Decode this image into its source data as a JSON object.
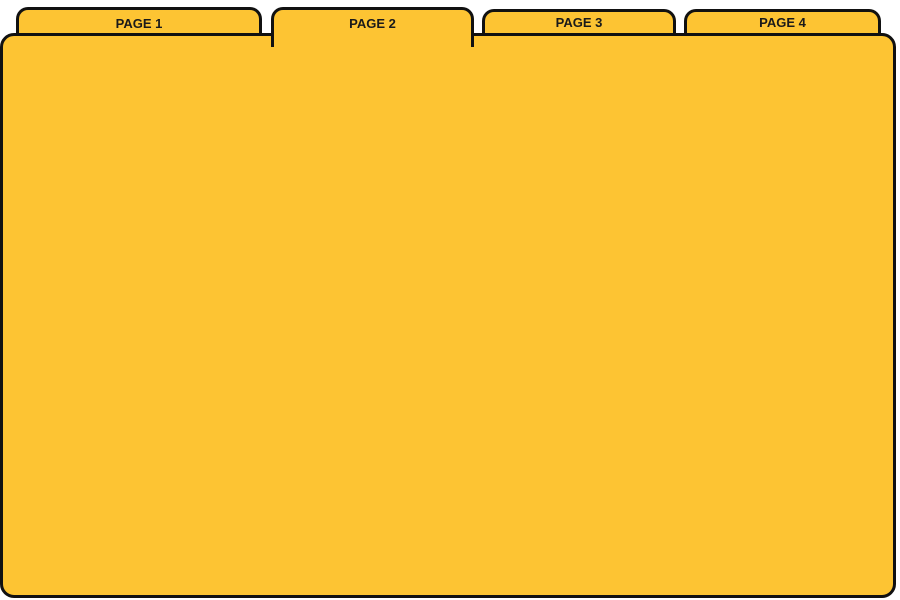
{
  "colors": {
    "folder_fill": "#FDC433",
    "outline": "#111111",
    "label_text": "#1a1a1a"
  },
  "tabs": [
    {
      "label": "PAGE 1",
      "active": false
    },
    {
      "label": "PAGE 2",
      "active": true
    },
    {
      "label": "PAGE 3",
      "active": false
    },
    {
      "label": "PAGE 4",
      "active": false
    }
  ]
}
